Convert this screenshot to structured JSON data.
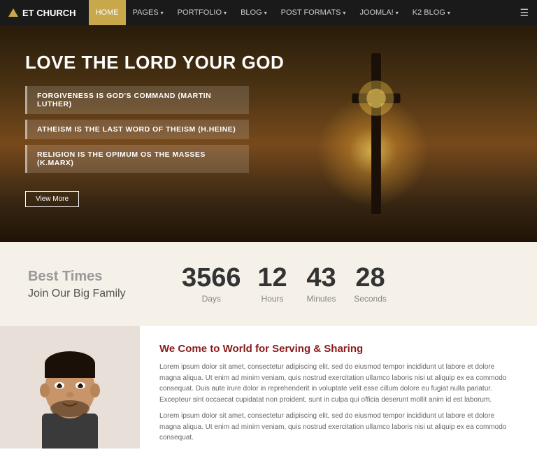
{
  "nav": {
    "logo": "ET CHURCH",
    "menu": [
      {
        "label": "HOME",
        "active": true
      },
      {
        "label": "PAGES",
        "dropdown": true
      },
      {
        "label": "PORTFOLIO",
        "dropdown": true
      },
      {
        "label": "BLOG",
        "dropdown": true
      },
      {
        "label": "POST FORMATS",
        "dropdown": true
      },
      {
        "label": "JOOMLA!",
        "dropdown": true
      },
      {
        "label": "K2 BLOG",
        "dropdown": true
      }
    ]
  },
  "hero": {
    "title": "LOVE THE LORD YOUR GOD",
    "quotes": [
      "FORGIVENESS IS GOD'S COMMAND (Martin Luther)",
      "ATHEISM IS THE LAST WORD OF THEISM (H.Heine)",
      "RELIGION IS THE OPIMUM OS THE MASSES (K.Marx)"
    ],
    "button_label": "View More"
  },
  "countdown": {
    "heading": "Best Times",
    "subheading": "Join Our Big Family",
    "units": [
      {
        "value": "3566",
        "label": "Days"
      },
      {
        "value": "12",
        "label": "Hours"
      },
      {
        "value": "43",
        "label": "Minutes"
      },
      {
        "value": "28",
        "label": "Seconds"
      }
    ]
  },
  "about": {
    "title": "We Come to World for Serving & Sharing",
    "paragraph1": "Lorem ipsum dolor sit amet, consectetur adipiscing elit, sed do eiusmod tempor incididunt ut labore et dolore magna aliqua. Ut enim ad minim veniam, quis nostrud exercitation ullamco laboris nisi ut aliquip ex ea commodo consequat. Duis aute irure dolor in reprehenderit in voluptate velit esse cillum dolore eu fugiat nulla pariatur. Excepteur sint occaecat cupidatat non proident, sunt in culpa qui officia deserunt mollit anim id est laborum.",
    "paragraph2": "Lorem ipsum dolor sit amet, consectetur adipiscing elit, sed do eiusmod tempor incididunt ut labore et dolore magna aliqua. Ut enim ad minim veniam, quis nostrud exercitation ullamco laboris nisi ut aliquip ex ea commodo consequat."
  }
}
